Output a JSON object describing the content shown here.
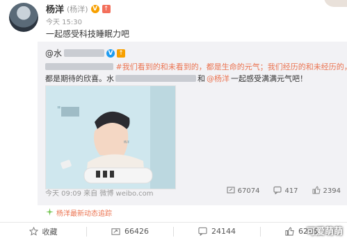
{
  "author": {
    "name": "杨洋",
    "paren": "(杨洋)",
    "verified_glyph": "V",
    "up_glyph": "↑",
    "time": "今天 15:30"
  },
  "post": {
    "text": "一起感受科技睡眠力吧"
  },
  "repost": {
    "at_prefix": "@水",
    "line1_hashtag": "#我们看到的和未看到的，都是生命的元气；我们经历的和未经历的，",
    "line2": "都是期待的欣喜。",
    "line2_prefix": "#杨洋代言",
    "line3_prefix": "都是期待的欣喜。水",
    "line3_link": "@杨洋",
    "line3_mid": "和",
    "line3_end": "一起感受满满元气吧！",
    "meta": "今天 09:09 来自 微博 weibo.com",
    "share_count": "67074",
    "comment_count": "417",
    "like_count": "2394"
  },
  "tracker": {
    "label": "杨洋最新动态追踪"
  },
  "actions": {
    "favorite": "收藏",
    "share": "66426",
    "comment": "24144",
    "like": "62264"
  },
  "watermark": "可爱萌萌",
  "colors": {
    "link": "#eb7350",
    "meta": "#999999",
    "repost_bg": "#f2f2f5"
  }
}
